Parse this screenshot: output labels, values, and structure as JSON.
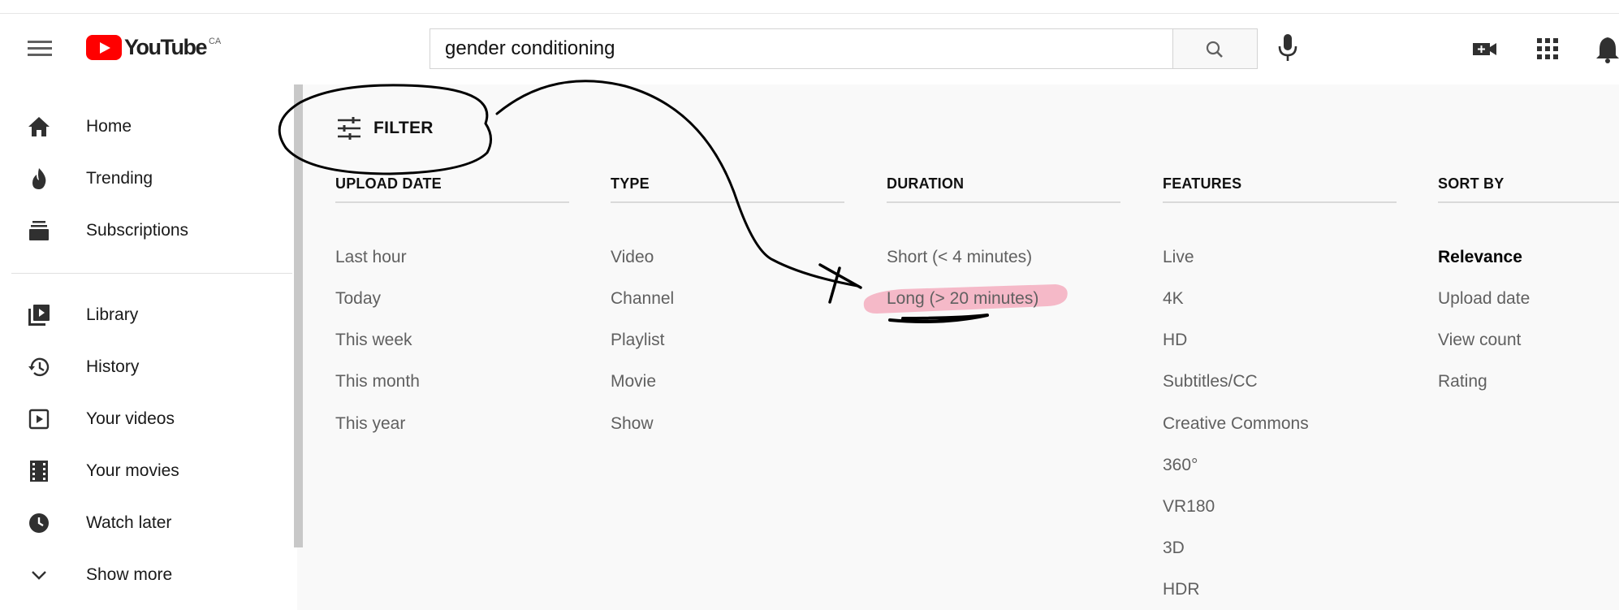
{
  "masthead": {
    "logo_text": "YouTube",
    "country": "CA",
    "search_value": "gender conditioning"
  },
  "sidebar": {
    "items": [
      {
        "label": "Home",
        "icon": "home-icon"
      },
      {
        "label": "Trending",
        "icon": "trending-icon"
      },
      {
        "label": "Subscriptions",
        "icon": "subscriptions-icon"
      },
      {
        "label": "Library",
        "icon": "library-icon"
      },
      {
        "label": "History",
        "icon": "history-icon"
      },
      {
        "label": "Your videos",
        "icon": "your-videos-icon"
      },
      {
        "label": "Your movies",
        "icon": "movies-icon"
      },
      {
        "label": "Watch later",
        "icon": "clock-icon"
      },
      {
        "label": "Show more",
        "icon": "chevron-down-icon"
      }
    ]
  },
  "filter": {
    "label": "FILTER",
    "columns": [
      {
        "title": "UPLOAD DATE",
        "options": [
          "Last hour",
          "Today",
          "This week",
          "This month",
          "This year"
        ]
      },
      {
        "title": "TYPE",
        "options": [
          "Video",
          "Channel",
          "Playlist",
          "Movie",
          "Show"
        ]
      },
      {
        "title": "DURATION",
        "options": [
          "Short (< 4 minutes)",
          "Long (> 20 minutes)"
        ]
      },
      {
        "title": "FEATURES",
        "options": [
          "Live",
          "4K",
          "HD",
          "Subtitles/CC",
          "Creative Commons",
          "360°",
          "VR180",
          "3D",
          "HDR"
        ]
      },
      {
        "title": "SORT BY",
        "options": [
          "Relevance",
          "Upload date",
          "View count",
          "Rating"
        ],
        "selected": "Relevance"
      }
    ]
  },
  "colors": {
    "brand_red": "#ff0000",
    "highlight_pink": "#f5aebf",
    "annotation_ink": "#000000"
  }
}
